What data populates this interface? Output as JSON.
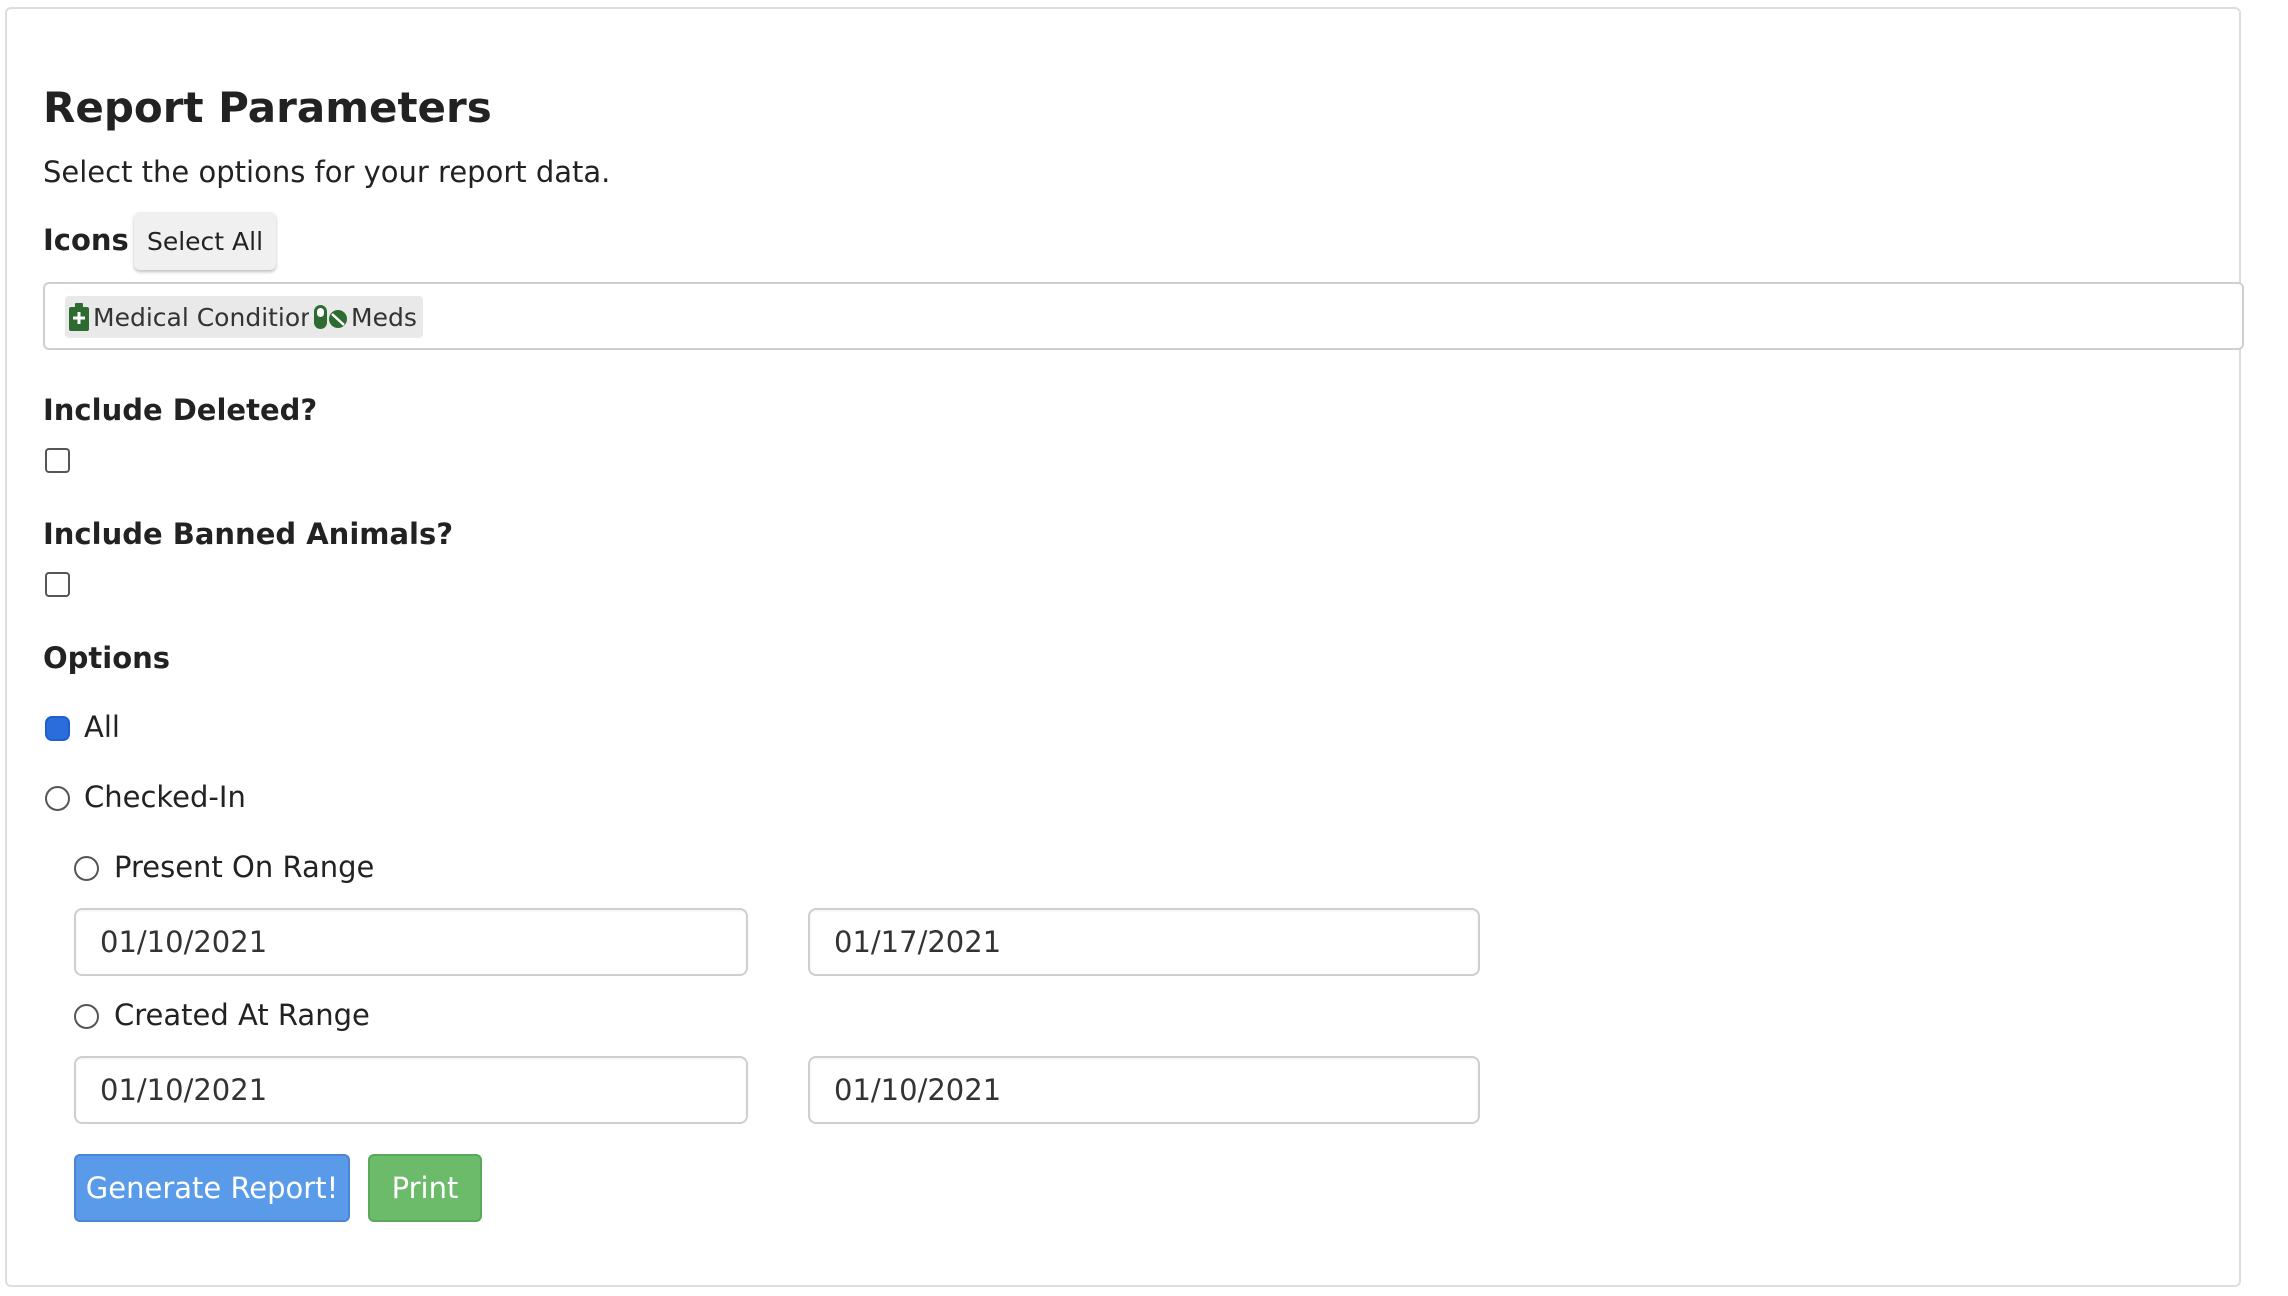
{
  "header": {
    "title": "Report Parameters",
    "subtitle": "Select the options for your report data."
  },
  "icons_section": {
    "label": "Icons",
    "select_all_label": "Select All",
    "tags": [
      {
        "label": "Medical Condition",
        "icon": "medical-kit-icon",
        "color": "#2e6b30"
      },
      {
        "label": "Meds",
        "icon": "pills-icon",
        "color": "#2e6b30"
      }
    ]
  },
  "include_deleted": {
    "label": "Include Deleted?",
    "checked": false
  },
  "include_banned": {
    "label": "Include Banned Animals?",
    "checked": false
  },
  "options": {
    "label": "Options",
    "choices": [
      {
        "label": "All",
        "selected": true
      },
      {
        "label": "Checked-In",
        "selected": false
      }
    ],
    "present_on_range": {
      "label": "Present On Range",
      "selected": false,
      "start": "01/10/2021",
      "end": "01/17/2021"
    },
    "created_at_range": {
      "label": "Created At Range",
      "selected": false,
      "start": "01/10/2021",
      "end": "01/10/2021"
    }
  },
  "actions": {
    "generate_label": "Generate Report!",
    "print_label": "Print"
  },
  "colors": {
    "primary": "#5a9be9",
    "success": "#6cbb6b",
    "radio_selected": "#2a6ddb"
  }
}
